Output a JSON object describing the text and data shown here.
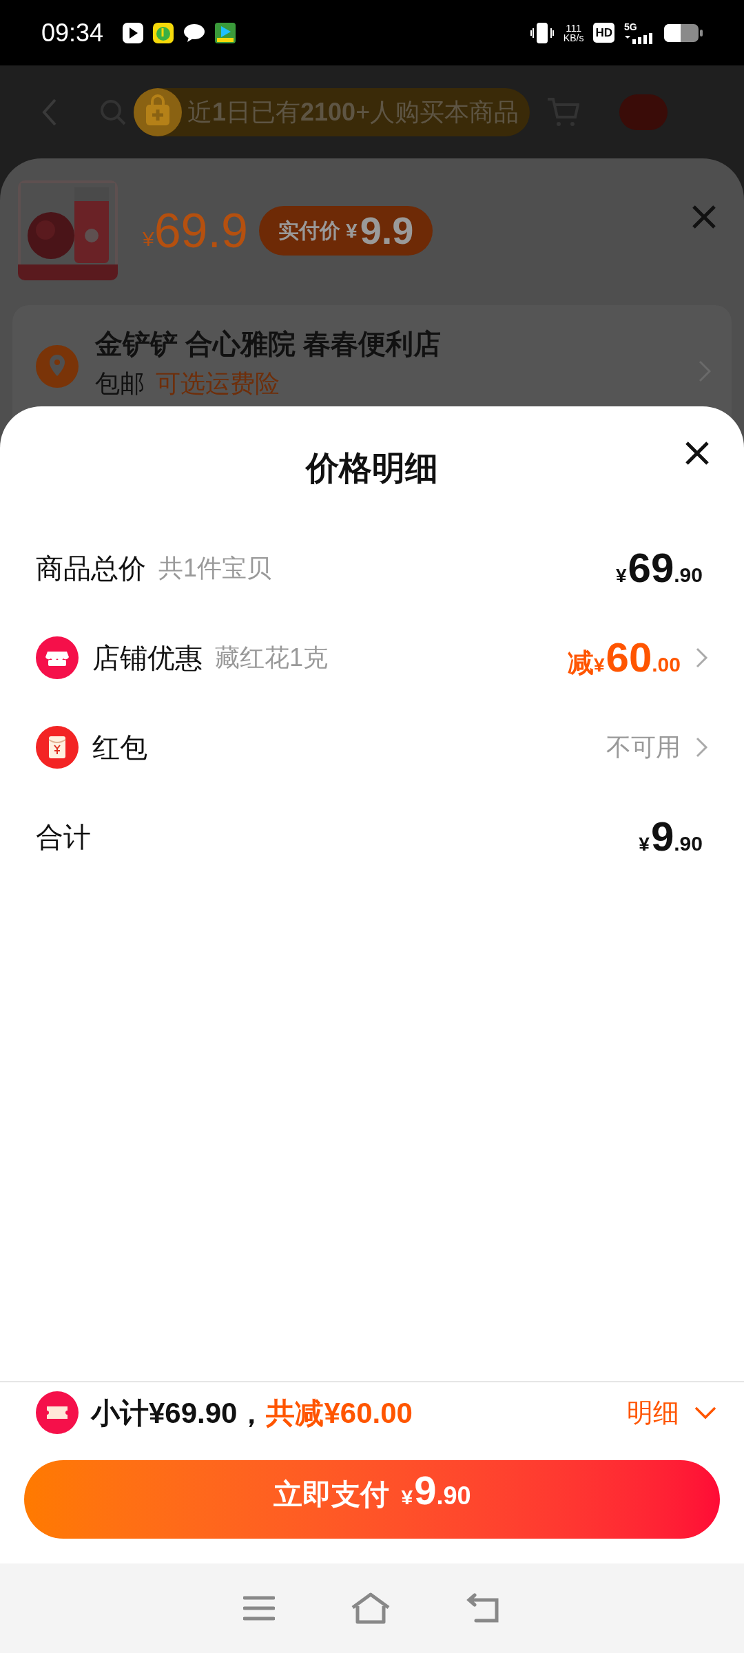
{
  "status_bar": {
    "time": "09:34",
    "speed_value": "111",
    "speed_unit": "KB/s",
    "hd": "HD",
    "network": "5G"
  },
  "top_bar": {
    "banner": "近**1**日已有**2100**+人购买本商品"
  },
  "product": {
    "price_symbol": "¥",
    "price": "69.9",
    "badge_label": "实付价",
    "badge_symbol": "¥",
    "badge_price": "9.9"
  },
  "address": {
    "line": "金铲铲 合心雅院 春春便利店",
    "shipping": "包邮",
    "insurance": "可选运费险"
  },
  "sheet": {
    "title": "价格明细",
    "rows": [
      {
        "kind": "amount",
        "label": "商品总价",
        "note": "共1件宝贝",
        "symbol": "¥",
        "integer": "69",
        "decimal": ".90"
      },
      {
        "kind": "discount",
        "label": "店铺优惠",
        "note": "藏红花1克",
        "prefix": "减",
        "symbol": "¥",
        "integer": "60",
        "decimal": ".00"
      },
      {
        "kind": "status",
        "label": "红包",
        "value": "不可用"
      },
      {
        "kind": "amount",
        "label": "合计",
        "symbol": "¥",
        "integer": "9",
        "decimal": ".90"
      }
    ]
  },
  "footer": {
    "subtotal": "小计¥69.90，",
    "saving": "共减¥60.00",
    "detail_link": "明细",
    "pay_label": "立即支付",
    "pay_symbol": "¥",
    "pay_integer": "9",
    "pay_decimal": ".90"
  }
}
